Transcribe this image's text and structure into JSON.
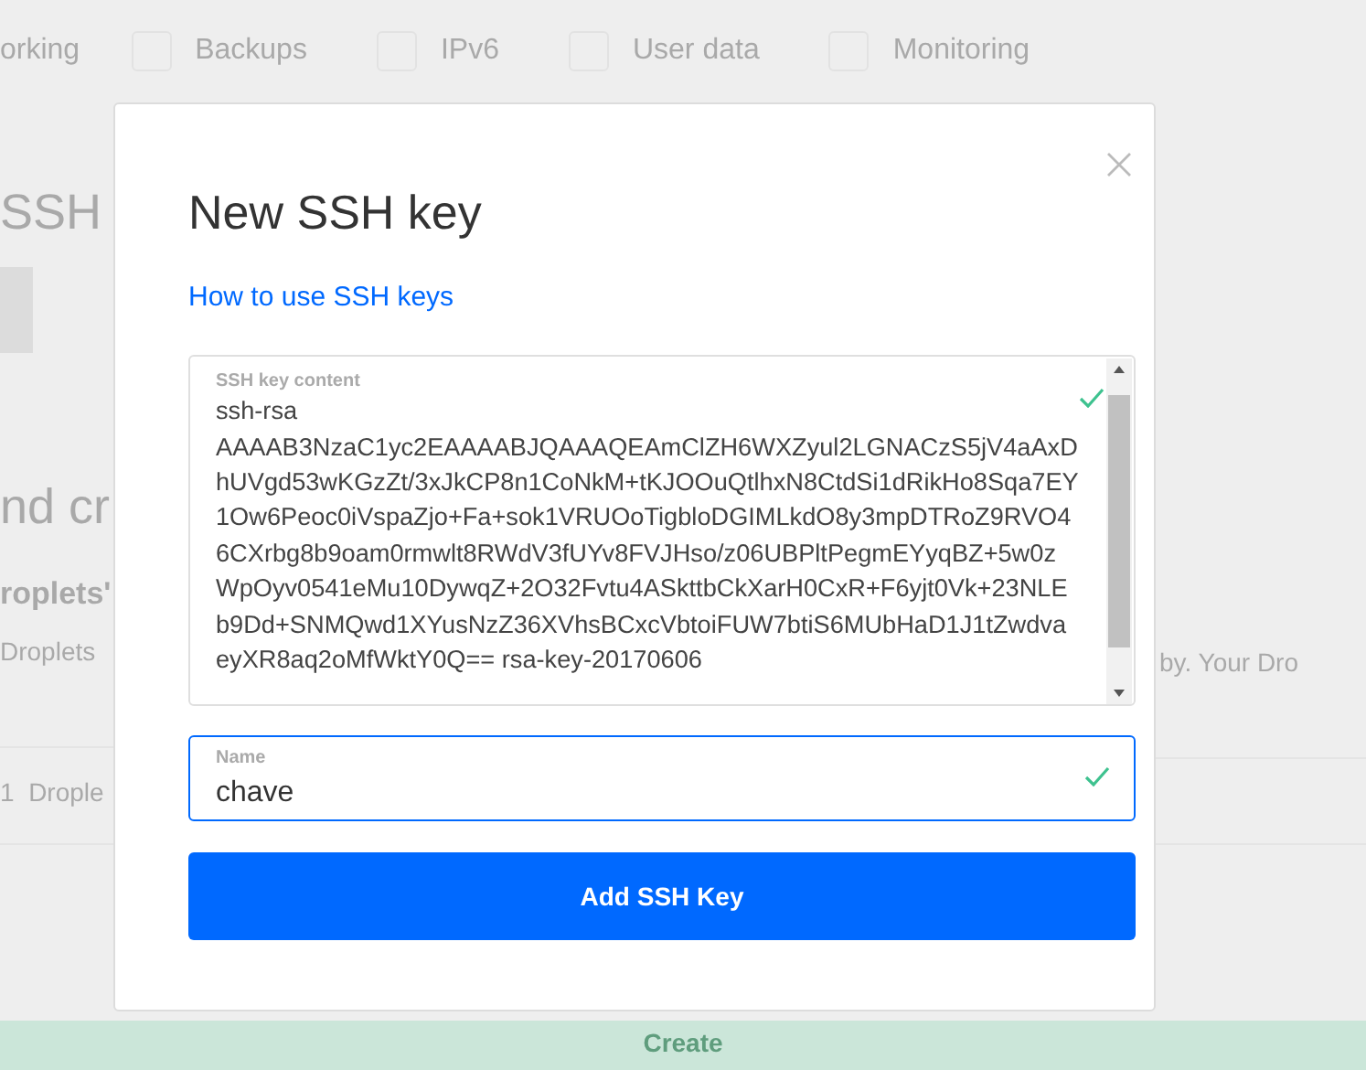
{
  "background": {
    "option_fragment": "orking",
    "options": [
      {
        "label": "Backups",
        "checked": false
      },
      {
        "label": "IPv6",
        "checked": false
      },
      {
        "label": "User data",
        "checked": false
      },
      {
        "label": "Monitoring",
        "checked": false
      }
    ],
    "heading": "SSH",
    "section_heading": "nd cr",
    "question": "roplets'",
    "paragraph_left": "Droplets",
    "paragraph_right": "by. Your Dro",
    "count": "1  Drople",
    "create_button": "Create"
  },
  "modal": {
    "title": "New SSH key",
    "help_link": "How to use SSH keys",
    "key_field": {
      "label": "SSH key content",
      "value": "ssh-rsa AAAAB3NzaC1yc2EAAAABJQAAAQEAmClZH6WXZyul2LGNACzS5jV4aAxDhUVgd53wKGzZt/3xJkCP8n1CoNkM+tKJOOuQtlhxN8CtdSi1dRikHo8Sqa7EY1Ow6Peoc0iVspaZjo+Fa+sok1VRUOoTigbloDGIMLkdO8y3mpDTRoZ9RVO46CXrbg8b9oam0rmwlt8RWdV3fUYv8FVJHso/z06UBPltPegmEYyqBZ+5w0zWpOyv0541eMu10DywqZ+2O32Fvtu4ASkttbCkXarH0CxR+F6yjt0Vk+23NLEb9Dd+SNMQwd1XYusNzZ36XVhsBCxcVbtoiFUW7btiS6MUbHaD1J1tZwdvaeyXR8aq2oMfWktY0Q== rsa-key-20170606",
      "valid": true
    },
    "name_field": {
      "label": "Name",
      "value": "chave",
      "valid": true,
      "focused": true
    },
    "submit_button": "Add SSH Key"
  }
}
